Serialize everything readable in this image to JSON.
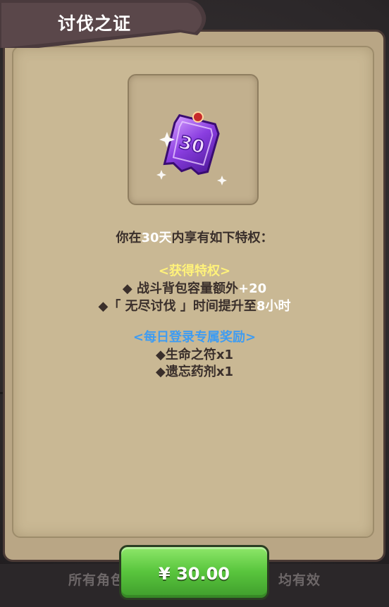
{
  "dialog": {
    "title": "讨伐之证"
  },
  "item": {
    "icon": "purple-badge-30-icon",
    "badge_number": "30"
  },
  "intro": {
    "prefix": "你在",
    "days": "30天",
    "suffix": "内享有如下特权："
  },
  "privileges": {
    "heading": "<获得特权>",
    "line1_text": "◆ 战斗背包容量额外",
    "line1_value": "+20",
    "line2_text": "◆「 无尽讨伐 」时间提升至",
    "line2_value": "8小时"
  },
  "daily_rewards": {
    "heading": "<每日登录专属奖励>",
    "items": [
      "◆生命之符x1",
      "◆遗忘药剂x1"
    ]
  },
  "purchase": {
    "price_label": "¥ 30.00"
  },
  "footer": {
    "left_text": "所有角色",
    "right_text": "均有效"
  },
  "colors": {
    "panel": "#c9b894",
    "highlight_yellow": "#fff27a",
    "highlight_blue": "#3e9cf2",
    "button_green": "#59c53d",
    "banner": "#4a3a3d"
  }
}
